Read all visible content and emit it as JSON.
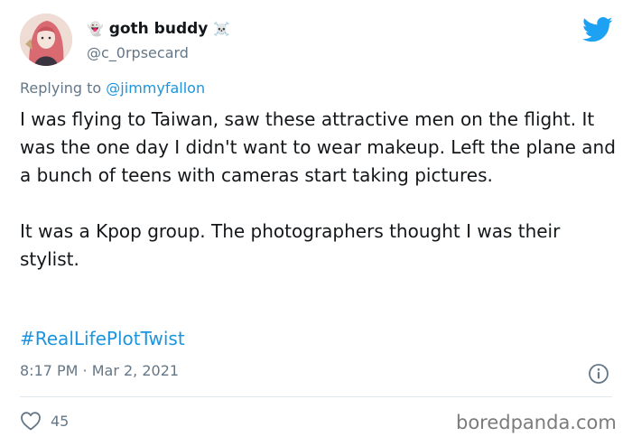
{
  "tweet": {
    "display_name": "goth buddy",
    "name_emoji_left": "👻",
    "name_emoji_right": "☠️",
    "handle": "@c_0rpsecard",
    "replying_prefix": "Replying to ",
    "replying_to": "@jimmyfallon",
    "paragraph_1": "I was flying to Taiwan, saw these attractive men on the flight. It was the one day I didn't want to wear makeup. Left the plane and a bunch of teens with cameras start taking pictures.",
    "paragraph_2": "It was a Kpop group. The photographers thought I was their stylist.",
    "hashtag": "#RealLifePlotTwist",
    "timestamp": "8:17 PM · Mar 2, 2021",
    "like_count": "45"
  },
  "watermark": "boredpanda.com",
  "colors": {
    "link_blue": "#1b95e0",
    "muted_gray": "#657786",
    "twitter_blue": "#1da1f2",
    "text": "#14171a"
  },
  "icons": [
    "twitter-bird-icon",
    "info-icon",
    "heart-icon"
  ]
}
